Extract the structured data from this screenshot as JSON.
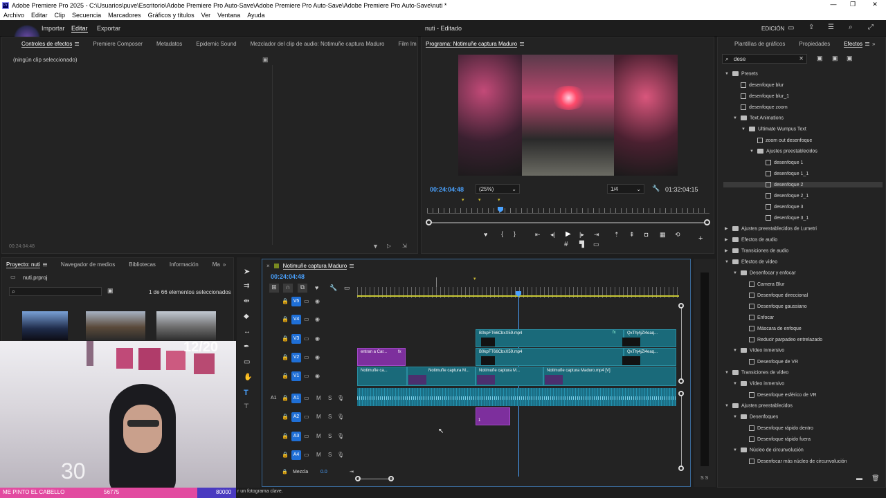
{
  "window": {
    "title": "Adobe Premiere Pro 2025 - C:\\Usuarios\\puve\\Escritorio\\Adobe Premiere Pro Auto-Save\\Adobe Premiere Pro Auto-Save\\Adobe Premiere Pro Auto-Save\\nuti *"
  },
  "menu": [
    "Archivo",
    "Editar",
    "Clip",
    "Secuencia",
    "Marcadores",
    "Gráficos y títulos",
    "Ver",
    "Ventana",
    "Ayuda"
  ],
  "workspace": {
    "tabs": [
      "Importar",
      "Editar",
      "Exportar"
    ],
    "active": "Editar",
    "project_title": "nuti - Editado",
    "mode": "EDICIÓN"
  },
  "source_panel": {
    "tabs": [
      "Controles de efectos",
      "Premiere Composer",
      "Metadatos",
      "Epidemic Sound",
      "Mezclador del clip de audio: Notimuñe captura Maduro",
      "Film Im"
    ],
    "empty_text": "(ningún clip seleccionado)",
    "timecode": "00:24:04:48"
  },
  "program": {
    "title": "Programa: Notimuñe captura Maduro",
    "timecode": "00:24:04:48",
    "zoom": "(25%)",
    "quality": "1/4",
    "duration": "01:32:04:15"
  },
  "effects_panel": {
    "tabs": [
      "Plantillas de gráficos",
      "Propiedades",
      "Efectos"
    ],
    "search_value": "dese",
    "tree": [
      {
        "label": "Presets",
        "level": 0,
        "type": "folder",
        "open": true
      },
      {
        "label": "desenfoque blur",
        "level": 1,
        "type": "preset"
      },
      {
        "label": "desenfoque blur_1",
        "level": 1,
        "type": "preset"
      },
      {
        "label": "desenfoque zoom",
        "level": 1,
        "type": "preset"
      },
      {
        "label": "Text Animations",
        "level": 1,
        "type": "folder",
        "open": true
      },
      {
        "label": "Ultimate Wumpus Text",
        "level": 2,
        "type": "folder",
        "open": true
      },
      {
        "label": "zoom out desenfoque",
        "level": 3,
        "type": "preset"
      },
      {
        "label": "Ajustes preestablecidos",
        "level": 3,
        "type": "folder",
        "open": true
      },
      {
        "label": "desenfoque 1",
        "level": 4,
        "type": "preset"
      },
      {
        "label": "desenfoque 1_1",
        "level": 4,
        "type": "preset"
      },
      {
        "label": "desenfoque 2",
        "level": 4,
        "type": "preset",
        "selected": true
      },
      {
        "label": "desenfoque 2_1",
        "level": 4,
        "type": "preset"
      },
      {
        "label": "desenfoque 3",
        "level": 4,
        "type": "preset"
      },
      {
        "label": "desenfoque 3_1",
        "level": 4,
        "type": "preset"
      },
      {
        "label": "Ajustes preestablecidos de Lumetri",
        "level": 0,
        "type": "folder",
        "open": false
      },
      {
        "label": "Efectos de audio",
        "level": 0,
        "type": "folder",
        "open": false
      },
      {
        "label": "Transiciones de audio",
        "level": 0,
        "type": "folder",
        "open": false
      },
      {
        "label": "Efectos de vídeo",
        "level": 0,
        "type": "folder",
        "open": true
      },
      {
        "label": "Desenfocar y enfocar",
        "level": 1,
        "type": "folder",
        "open": true
      },
      {
        "label": "Camera Blur",
        "level": 2,
        "type": "effect"
      },
      {
        "label": "Desenfoque direccional",
        "level": 2,
        "type": "effect"
      },
      {
        "label": "Desenfoque gaussiano",
        "level": 2,
        "type": "effect"
      },
      {
        "label": "Enfocar",
        "level": 2,
        "type": "effect"
      },
      {
        "label": "Máscara de enfoque",
        "level": 2,
        "type": "effect"
      },
      {
        "label": "Reducir parpadeo entrelazado",
        "level": 2,
        "type": "effect"
      },
      {
        "label": "Vídeo inmersivo",
        "level": 1,
        "type": "folder",
        "open": true
      },
      {
        "label": "Desenfoque de VR",
        "level": 2,
        "type": "effect"
      },
      {
        "label": "Transiciones de vídeo",
        "level": 0,
        "type": "folder",
        "open": true
      },
      {
        "label": "Vídeo inmersivo",
        "level": 1,
        "type": "folder",
        "open": true
      },
      {
        "label": "Desenfoque esférico de VR",
        "level": 2,
        "type": "effect"
      },
      {
        "label": "Ajustes preestablecidos",
        "level": 0,
        "type": "folder",
        "open": true
      },
      {
        "label": "Desenfoques",
        "level": 1,
        "type": "folder",
        "open": true
      },
      {
        "label": "Desenfoque rápido dentro",
        "level": 2,
        "type": "effect"
      },
      {
        "label": "Desenfoque rápido fuera",
        "level": 2,
        "type": "effect"
      },
      {
        "label": "Núcleo de circunvolución",
        "level": 1,
        "type": "folder",
        "open": true
      },
      {
        "label": "Desenfocar más núcleo de circunvolución",
        "level": 2,
        "type": "effect"
      }
    ]
  },
  "project_panel": {
    "tabs": [
      "Proyecto: nuti",
      "Navegador de medios",
      "Bibliotecas",
      "Información",
      "Ma"
    ],
    "file": "nuti.prproj",
    "selection": "1 de 66 elementos seleccionados"
  },
  "timeline": {
    "title": "Notimuñe captura Maduro",
    "timecode": "00:24:04:48",
    "video_tracks": [
      "V5",
      "V4",
      "V3",
      "V2",
      "V1"
    ],
    "audio_tracks": [
      "A1",
      "A2",
      "A3",
      "A4"
    ],
    "source_patch": "A1",
    "track_toggles": [
      "M",
      "S"
    ],
    "mix_label": "Mezcla",
    "mix_value": "0.0",
    "clips": {
      "v3_a": "B0kpFT66CbxX59.mp4",
      "v3_b": "QxThj4jZl4eaq...",
      "v2_purple": "entran a Car...",
      "v2_a": "B0kpFT66CbxX59.mp4",
      "v2_b": "QxThj4jZl4eaq...",
      "v1_a": "Notimuñe ca...",
      "v1_b": "Notimuñe captura M...",
      "v1_c": "Notimuñe captura M...",
      "v1_d": "Notimuñe captura Maduro.mp4 [V]",
      "audio_purple_num": "1"
    },
    "fx_badge": "fx"
  },
  "overlay": {
    "counter": "12/20",
    "stream_text": "ME PINTO EL CABELLO",
    "stream_count": "56775",
    "stream_goal": "80000",
    "big_timer": "30"
  },
  "status_text": "r un fotograma clave.",
  "audio_meter_labels": "S S",
  "colors": {
    "accent_blue": "#4aa2ff",
    "clip_teal": "#1a6a7a",
    "clip_purple": "#7d2f9d",
    "playhead": "#4aa2ff"
  }
}
